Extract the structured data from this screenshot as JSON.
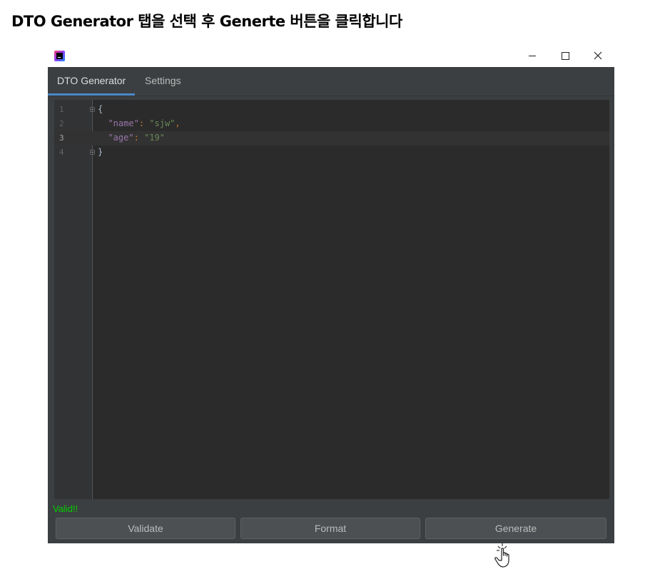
{
  "instruction": "DTO Generator 탭을 선택 후 Generte 버튼을 클릭합니다",
  "window": {
    "controls": {
      "minimize": "–",
      "maximize": "□",
      "close": "×"
    }
  },
  "tabs": [
    {
      "label": "DTO Generator",
      "active": true
    },
    {
      "label": "Settings",
      "active": false
    }
  ],
  "editor": {
    "lines": [
      {
        "number": "1",
        "open": "{"
      },
      {
        "number": "2",
        "key": "\"name\"",
        "sep": ": ",
        "value": "\"sjw\"",
        "end": ","
      },
      {
        "number": "3",
        "key": "\"age\"",
        "sep": ": ",
        "value": "\"19\"",
        "end": ""
      },
      {
        "number": "4",
        "close": "}"
      }
    ],
    "current_line": "3"
  },
  "status": {
    "text": "Valid!!",
    "color": "#00d000"
  },
  "buttons": {
    "validate": "Validate",
    "format": "Format",
    "generate": "Generate"
  },
  "colors": {
    "accent": "#4a88c7",
    "background": "#3c3f41",
    "editor_bg": "#2b2b2b"
  },
  "icons": {
    "app": "intellij-app-icon",
    "cursor": "hand-pointer-click-icon"
  }
}
